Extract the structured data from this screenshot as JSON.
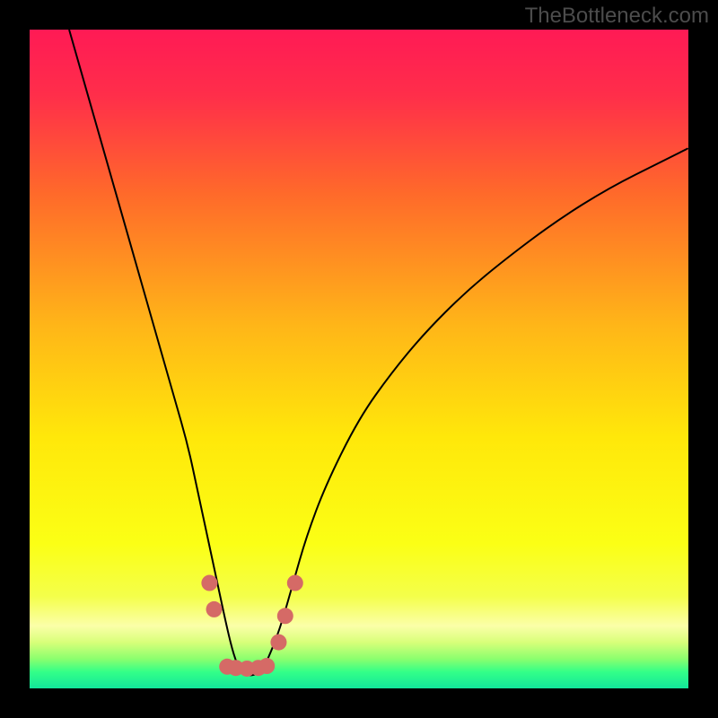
{
  "watermark": "TheBottleneck.com",
  "chart_data": {
    "type": "line",
    "title": "",
    "xlabel": "",
    "ylabel": "",
    "xlim": [
      0,
      100
    ],
    "ylim": [
      0,
      100
    ],
    "background_gradient": {
      "stops": [
        {
          "offset": 0,
          "color": "#ff1a55"
        },
        {
          "offset": 0.1,
          "color": "#ff2e4a"
        },
        {
          "offset": 0.25,
          "color": "#ff6a2a"
        },
        {
          "offset": 0.45,
          "color": "#ffb618"
        },
        {
          "offset": 0.62,
          "color": "#ffe80a"
        },
        {
          "offset": 0.78,
          "color": "#fbff15"
        },
        {
          "offset": 0.86,
          "color": "#f4ff4a"
        },
        {
          "offset": 0.905,
          "color": "#fbffa8"
        },
        {
          "offset": 0.93,
          "color": "#d8ff7a"
        },
        {
          "offset": 0.955,
          "color": "#8cff6e"
        },
        {
          "offset": 0.975,
          "color": "#33ff88"
        },
        {
          "offset": 1.0,
          "color": "#12e69a"
        }
      ]
    },
    "series": [
      {
        "name": "bottleneck-curve",
        "color": "#000000",
        "stroke_width": 2,
        "x": [
          6,
          8,
          10,
          12,
          14,
          16,
          18,
          20,
          22,
          24,
          25.5,
          27,
          28.5,
          30,
          31,
          32,
          33,
          34,
          35,
          36,
          38,
          40,
          42,
          45,
          50,
          55,
          60,
          66,
          72,
          80,
          88,
          96,
          100
        ],
        "y": [
          100,
          93,
          86,
          79,
          72,
          65,
          58,
          51,
          44,
          37,
          30,
          23,
          16,
          9,
          5,
          2.5,
          2,
          2,
          2.5,
          4,
          9,
          16,
          23,
          31,
          41,
          48,
          54,
          60,
          65,
          71,
          76,
          80,
          82
        ]
      }
    ],
    "markers": {
      "name": "highlight-dots",
      "color": "#d56a66",
      "radius": 9,
      "points": [
        {
          "x": 27.3,
          "y": 16
        },
        {
          "x": 28.0,
          "y": 12
        },
        {
          "x": 30.0,
          "y": 3.3
        },
        {
          "x": 31.3,
          "y": 3.1
        },
        {
          "x": 33.0,
          "y": 3.0
        },
        {
          "x": 34.7,
          "y": 3.1
        },
        {
          "x": 36.0,
          "y": 3.4
        },
        {
          "x": 37.8,
          "y": 7
        },
        {
          "x": 38.8,
          "y": 11
        },
        {
          "x": 40.3,
          "y": 16
        }
      ]
    }
  }
}
